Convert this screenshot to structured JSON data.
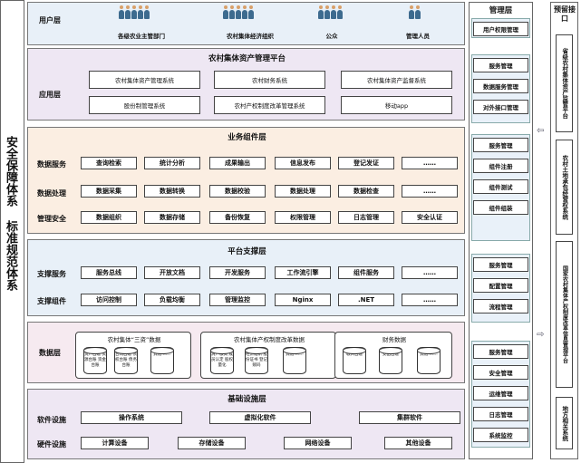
{
  "left_label": "安全保障体系 标准规范体系",
  "user_layer": {
    "label": "用户层",
    "users": [
      "各级农业主管部门",
      "农村集体经济组织",
      "公众",
      "管理人员"
    ]
  },
  "app_layer": {
    "label": "应用层",
    "title": "农村集体资产管理平台",
    "systems": [
      "农村集体资产管理系统",
      "农村财务系统",
      "农村集体资产监督系统",
      "股份制管理系统",
      "农村产权制度改革管理系统",
      "移动app"
    ]
  },
  "business_layer": {
    "title": "业务组件层",
    "rows": [
      {
        "label": "数据服务",
        "items": [
          "查询检索",
          "统计分析",
          "成果输出",
          "信息发布",
          "登记发证",
          "……"
        ]
      },
      {
        "label": "数据处理",
        "items": [
          "数据采集",
          "数据转换",
          "数据校验",
          "数据处理",
          "数据检查",
          "……"
        ]
      },
      {
        "label": "管理安全",
        "items": [
          "数据组织",
          "数据存储",
          "备份恢复",
          "权限管理",
          "日志管理",
          "安全认证"
        ]
      }
    ]
  },
  "platform_layer": {
    "title": "平台支撑层",
    "rows": [
      {
        "label": "支撑服务",
        "items": [
          "服务总线",
          "开放文档",
          "开发服务",
          "工作流引擎",
          "组件服务",
          "……"
        ]
      },
      {
        "label": "支撑组件",
        "items": [
          "访问控制",
          "负载均衡",
          "管理监控",
          "Nginx",
          ".NET",
          "……"
        ]
      }
    ]
  },
  "data_layer": {
    "label": "数据层",
    "groups": [
      {
        "title": "农村集体“三资”数据",
        "dbs": [
          "资产台账 资源台账 资金台账",
          "合同台账 债权台账 债务台账",
          "其他 ……"
        ]
      },
      {
        "title": "农村集体产权制度改革数据",
        "dbs": [
          "清产核资 成员认定 股权量化",
          "经济组织 股份证书 登记赋码",
          "其他 ……"
        ]
      },
      {
        "title": "财务数据",
        "dbs": [
          "收入台账",
          "支出台账",
          "其他 ……"
        ]
      }
    ]
  },
  "infra_layer": {
    "title": "基础设施层",
    "rows": [
      {
        "label": "软件设施",
        "items": [
          "操作系统",
          "虚拟化软件",
          "集群软件"
        ]
      },
      {
        "label": "硬件设施",
        "items": [
          "计算设备",
          "存储设备",
          "网络设备",
          "其他设备"
        ]
      }
    ]
  },
  "mgmt": {
    "title": "管理层",
    "groups": [
      [
        "用户权限管理"
      ],
      [
        "服务管理",
        "数据服务管理",
        "对外接口管理"
      ],
      [
        "服务管理",
        "组件注册",
        "组件测试",
        "组件组装"
      ],
      [
        "服务管理",
        "配置管理",
        "流程管理"
      ],
      [
        "服务管理",
        "安全管理",
        "运维管理",
        "日志管理",
        "系统监控"
      ]
    ]
  },
  "reserved": {
    "title": "预留接口",
    "items": [
      "省级农村集体资产监管平台",
      "农村土地承包经营权系统",
      "国家农村集体产权制度改革信息管理平台",
      "地方相关系统"
    ]
  }
}
